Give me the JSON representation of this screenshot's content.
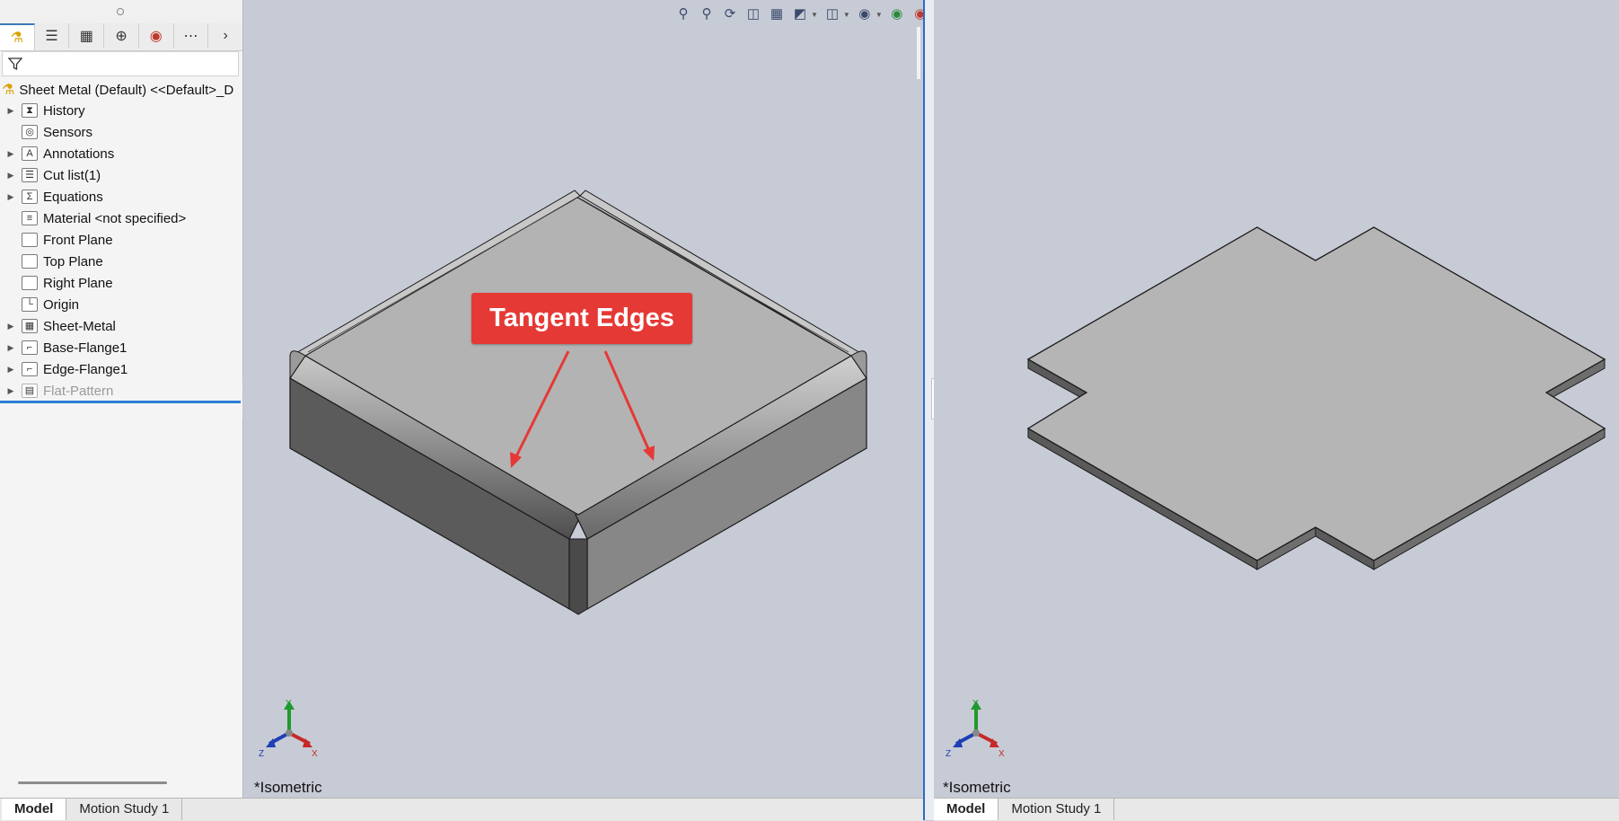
{
  "feature_manager": {
    "tabs": [
      "part-icon",
      "feature-tree-icon",
      "property-manager-icon",
      "configuration-icon",
      "appearance-icon",
      "more-icon"
    ],
    "filter_icon": "filter-icon",
    "root_label": "Sheet Metal (Default) <<Default>_D",
    "tree": [
      {
        "label": "History",
        "icon": "history-icon",
        "expandable": true
      },
      {
        "label": "Sensors",
        "icon": "sensors-icon",
        "expandable": false
      },
      {
        "label": "Annotations",
        "icon": "annotations-icon",
        "expandable": true
      },
      {
        "label": "Cut list(1)",
        "icon": "cut-list-icon",
        "expandable": true
      },
      {
        "label": "Equations",
        "icon": "equations-icon",
        "expandable": true
      },
      {
        "label": "Material <not specified>",
        "icon": "material-icon",
        "expandable": false
      },
      {
        "label": "Front Plane",
        "icon": "plane-icon",
        "expandable": false
      },
      {
        "label": "Top Plane",
        "icon": "plane-icon",
        "expandable": false
      },
      {
        "label": "Right Plane",
        "icon": "plane-icon",
        "expandable": false
      },
      {
        "label": "Origin",
        "icon": "origin-icon",
        "expandable": false
      },
      {
        "label": "Sheet-Metal",
        "icon": "sheet-metal-icon",
        "expandable": true
      },
      {
        "label": "Base-Flange1",
        "icon": "base-flange-icon",
        "expandable": true
      },
      {
        "label": "Edge-Flange1",
        "icon": "edge-flange-icon",
        "expandable": true
      },
      {
        "label": "Flat-Pattern",
        "icon": "flat-pattern-icon",
        "expandable": true,
        "suppressed": true
      }
    ]
  },
  "viewport_left": {
    "view_label": "*Isometric",
    "callout": "Tangent Edges",
    "triad": {
      "x": "X",
      "y": "Y",
      "z": "Z"
    },
    "tabs": {
      "model": "Model",
      "motion": "Motion Study 1"
    }
  },
  "viewport_right": {
    "view_label": "*Isometric",
    "triad": {
      "x": "X",
      "y": "Y",
      "z": "Z"
    },
    "tabs": {
      "model": "Model",
      "motion": "Motion Study 1"
    }
  },
  "colors": {
    "accent": "#2b7fd4",
    "callout": "#e53935",
    "background": "#c7cbd6"
  }
}
